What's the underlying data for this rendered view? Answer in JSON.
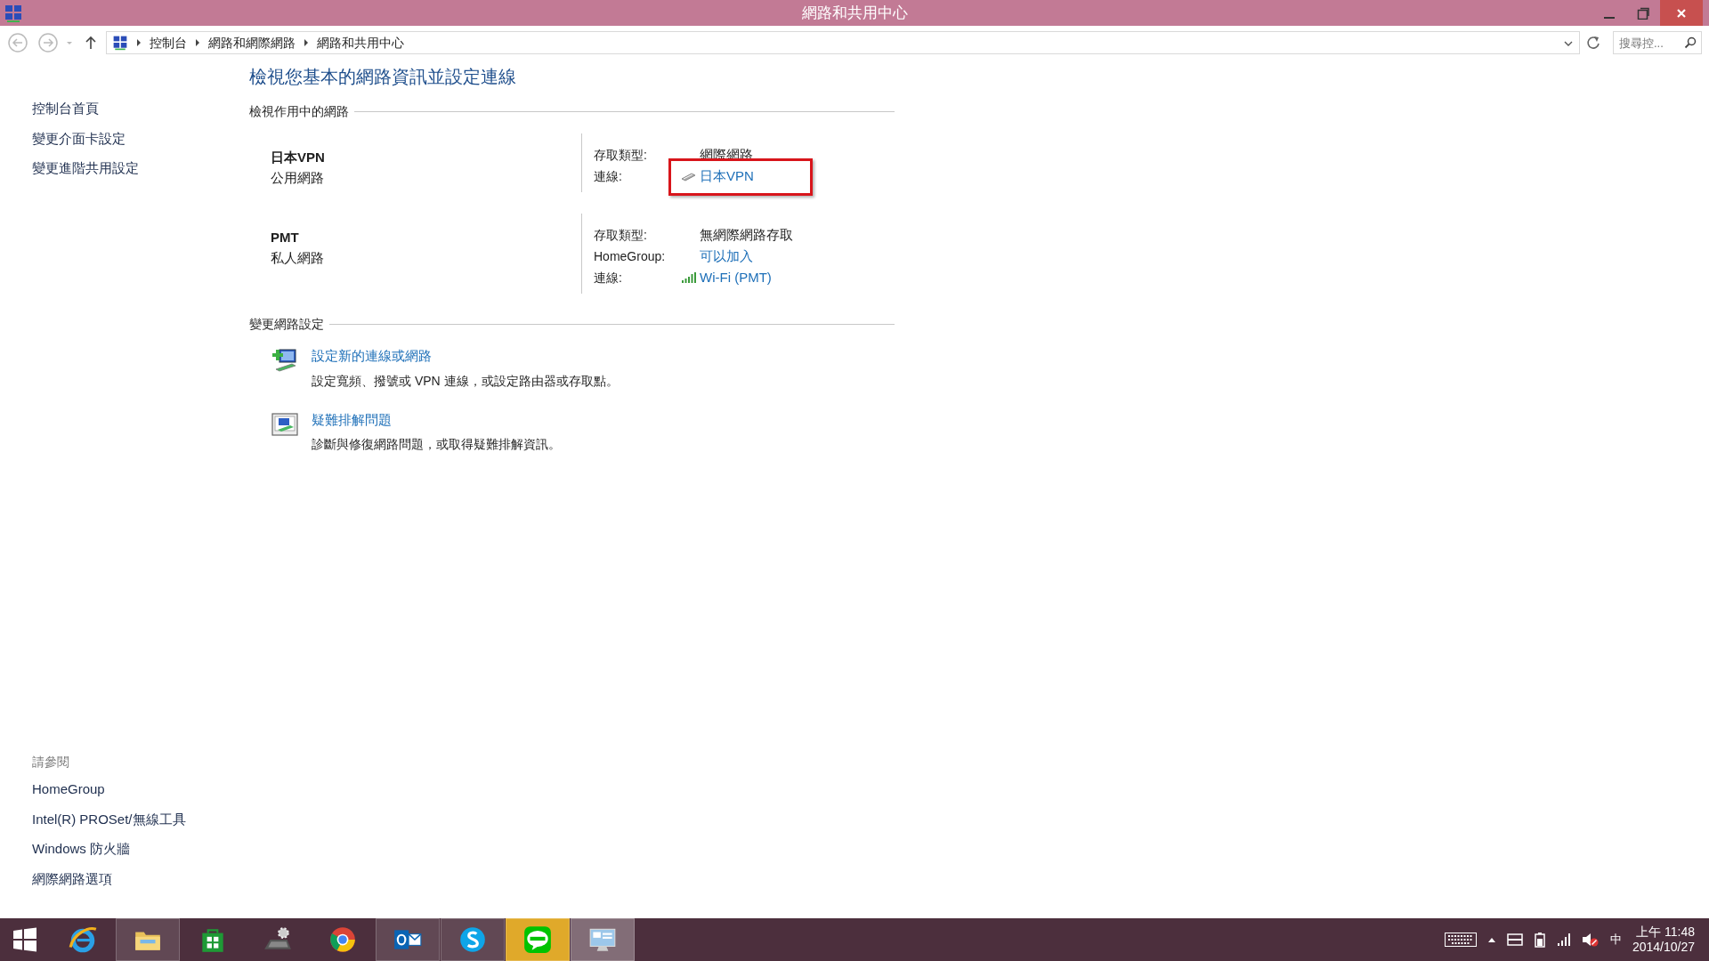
{
  "window": {
    "title": "網路和共用中心"
  },
  "address_bar": {
    "breadcrumbs": [
      "控制台",
      "網路和網際網路",
      "網路和共用中心"
    ]
  },
  "search": {
    "placeholder": "搜尋控..."
  },
  "sidebar": {
    "items": [
      "控制台首頁",
      "變更介面卡設定",
      "變更進階共用設定"
    ],
    "see_also_title": "請參閱",
    "see_also": [
      "HomeGroup",
      "Intel(R) PROSet/無線工具",
      "Windows 防火牆",
      "網際網路選項"
    ]
  },
  "page_title": "檢視您基本的網路資訊並設定連線",
  "active_networks": {
    "heading": "檢視作用中的網路",
    "networks": [
      {
        "name": "日本VPN",
        "category": "公用網路",
        "details": [
          {
            "label": "存取類型:",
            "value": "網際網路",
            "kind": "text",
            "highlighted": false
          },
          {
            "label": "連線:",
            "value": "日本VPN",
            "kind": "vpn",
            "highlighted": true
          }
        ]
      },
      {
        "name": "PMT",
        "category": "私人網路",
        "details": [
          {
            "label": "存取類型:",
            "value": "無網際網路存取",
            "kind": "text",
            "highlighted": false
          },
          {
            "label": "HomeGroup:",
            "value": "可以加入",
            "kind": "link",
            "highlighted": false
          },
          {
            "label": "連線:",
            "value": "Wi-Fi (PMT)",
            "kind": "wifi",
            "highlighted": false
          }
        ]
      }
    ]
  },
  "change_settings": {
    "heading": "變更網路設定",
    "tasks": [
      {
        "kind": "new-connection",
        "title": "設定新的連線或網路",
        "description": "設定寬頻、撥號或 VPN 連線，或設定路由器或存取點。"
      },
      {
        "kind": "troubleshoot",
        "title": "疑難排解問題",
        "description": "診斷與修復網路問題，或取得疑難排解資訊。"
      }
    ]
  },
  "taskbar": {
    "apps": [
      {
        "kind": "browser",
        "running": false,
        "selected": false
      },
      {
        "kind": "folder",
        "running": true,
        "selected": false
      },
      {
        "kind": "store",
        "running": false,
        "selected": false
      },
      {
        "kind": "settings",
        "running": false,
        "selected": false
      },
      {
        "kind": "chrome",
        "running": false,
        "selected": false
      },
      {
        "kind": "mail",
        "running": true,
        "selected": false
      },
      {
        "kind": "chat",
        "running": true,
        "selected": false
      },
      {
        "kind": "messenger",
        "running": true,
        "selected": true
      },
      {
        "kind": "control-panel",
        "running": true,
        "selected": true
      }
    ],
    "tray": {
      "ime": "中",
      "time": "上午 11:48",
      "date": "2014/10/27"
    }
  }
}
